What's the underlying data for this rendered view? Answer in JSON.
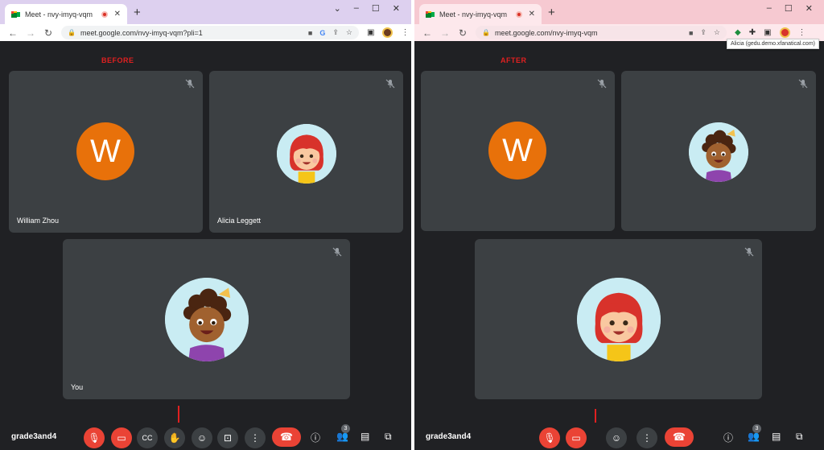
{
  "before": {
    "caption": "BEFORE",
    "tab_title": "Meet - nvy-imyq-vqm",
    "url": "meet.google.com/nvy-imyq-vqm?pli=1",
    "participants": [
      {
        "name": "William Zhou",
        "initial": "W"
      },
      {
        "name": "Alicia Leggett"
      },
      {
        "name": "You"
      }
    ],
    "meeting_code": "grade3and4",
    "people_count": "3"
  },
  "after": {
    "caption": "AFTER",
    "tab_title": "Meet - nvy-imyq-vqm",
    "url": "meet.google.com/nvy-imyq-vqm",
    "tooltip": "Alicia (gedu.demo.xfanatical.com)",
    "participants": [
      {
        "initial": "W"
      }
    ],
    "meeting_code": "grade3and4",
    "people_count": "3"
  },
  "colors": {
    "annotation_red": "#e02020",
    "meet_background": "#202124",
    "tile_background": "#3c4043",
    "avatar_orange": "#e8710a",
    "end_call_red": "#ea4335"
  }
}
